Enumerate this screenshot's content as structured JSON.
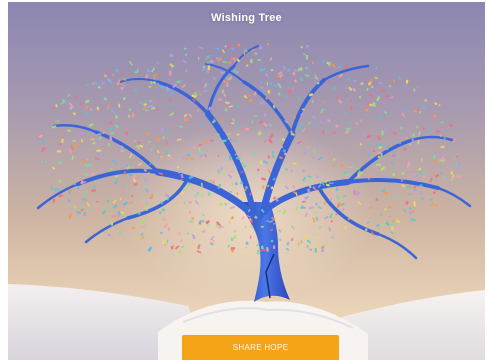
{
  "app": {
    "title": "Wishing Tree"
  },
  "actions": {
    "share_label": "SHARE HOPE"
  },
  "scene": {
    "tree": "wishing-tree-icon",
    "leaf_colors": [
      "#ef6f7f",
      "#f4a0a8",
      "#7fd8a6",
      "#5fc7c2",
      "#f0d860",
      "#f59a4a",
      "#66b8e8",
      "#b69be8",
      "#a8e07a"
    ],
    "branch_color": "#3b64d6",
    "button_color": "#f5a418"
  }
}
